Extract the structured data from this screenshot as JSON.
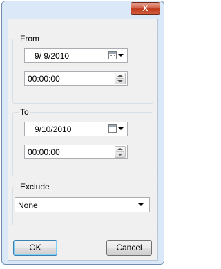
{
  "window": {
    "close_label": "X"
  },
  "from": {
    "label": "From",
    "date": "9/ 9/2010",
    "time": "00:00:00"
  },
  "to": {
    "label": "To",
    "date": "9/10/2010",
    "time": "00:00:00"
  },
  "exclude": {
    "label": "Exclude",
    "selected": "None"
  },
  "buttons": {
    "ok": "OK",
    "cancel": "Cancel"
  },
  "icons": {
    "calendar": "calendar-icon",
    "dropdown": "chevron-down-icon",
    "spinner": "spinner-icon",
    "close": "close-icon"
  }
}
